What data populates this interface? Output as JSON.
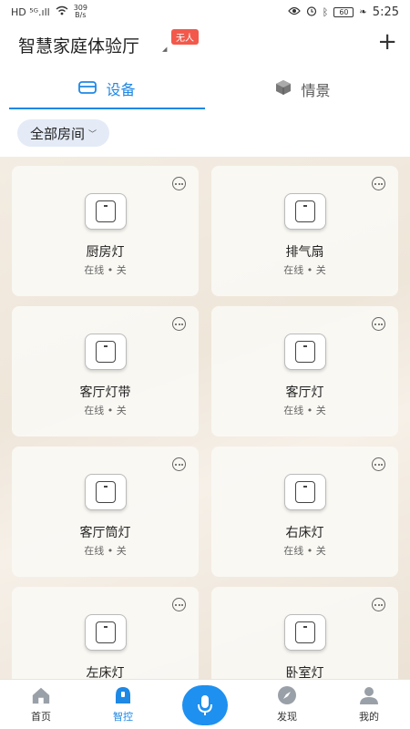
{
  "status_bar": {
    "left_text": "HD ⁵ᴳ.ıll",
    "speed_value": "309",
    "speed_unit": "B/s",
    "battery": "60",
    "time": "5:25"
  },
  "header": {
    "home_name": "智慧家庭体验厅",
    "badge": "无人",
    "add_icon": "plus-icon"
  },
  "tabs": [
    {
      "label": "设备",
      "icon": "device-icon",
      "active": true
    },
    {
      "label": "情景",
      "icon": "scene-cube-icon",
      "active": false
    }
  ],
  "room_filter": {
    "label": "全部房间"
  },
  "devices": [
    {
      "name": "厨房灯",
      "status": "在线 • 关"
    },
    {
      "name": "排气扇",
      "status": "在线 • 关"
    },
    {
      "name": "客厅灯带",
      "status": "在线 • 关"
    },
    {
      "name": "客厅灯",
      "status": "在线 • 关"
    },
    {
      "name": "客厅筒灯",
      "status": "在线 • 关"
    },
    {
      "name": "右床灯",
      "status": "在线 • 关"
    },
    {
      "name": "左床灯",
      "status": ""
    },
    {
      "name": "卧室灯",
      "status": ""
    }
  ],
  "bottom_nav": [
    {
      "label": "首页",
      "icon": "home-icon",
      "active": false
    },
    {
      "label": "智控",
      "icon": "smart-control-icon",
      "active": true
    },
    {
      "label": "",
      "icon": "microphone-icon",
      "active": false
    },
    {
      "label": "发现",
      "icon": "compass-icon",
      "active": false
    },
    {
      "label": "我的",
      "icon": "profile-icon",
      "active": false
    }
  ],
  "colors": {
    "accent": "#1e88e5",
    "badge": "#f2594b",
    "filter_bg": "#e4ebf7"
  }
}
